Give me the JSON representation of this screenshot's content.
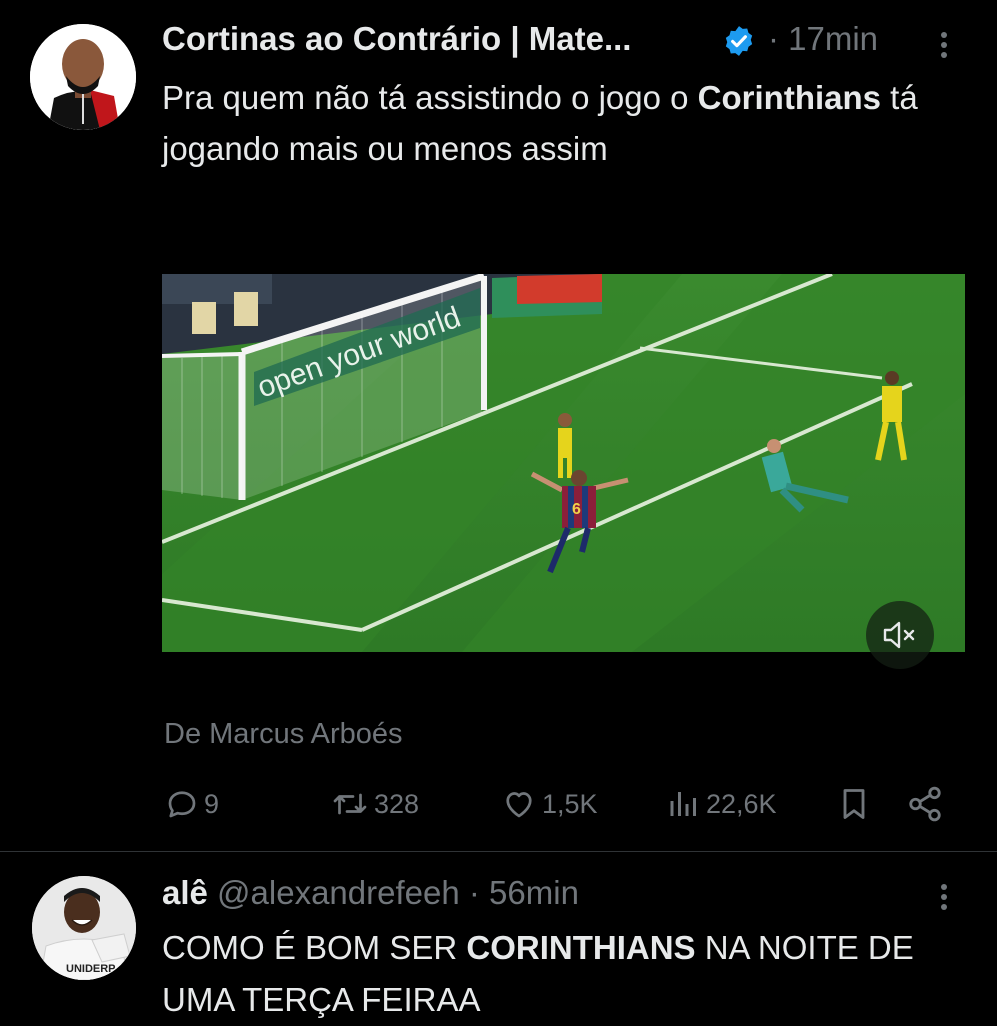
{
  "tweet1": {
    "author_name": "Cortinas ao Contrário | Mate...",
    "time": "· 17min",
    "text_before": "Pra quem não tá assistindo o jogo o ",
    "text_bold": "Corinthians",
    "text_after": " tá jogando mais ou menos assim",
    "media_banner_text": "open your world",
    "media_player_number": "6",
    "source": "De Marcus Arboés",
    "actions": {
      "replies": "9",
      "retweets": "328",
      "likes": "1,5K",
      "views": "22,6K"
    }
  },
  "tweet2": {
    "author_name": "alê",
    "handle": "@alexandrefeeh",
    "time": "· 56min",
    "text_before": "COMO É BOM SER ",
    "text_bold": "CORINTHIANS",
    "text_after": " NA NOITE DE UMA TERÇA FEIRAA",
    "avatar_shirt_text": "UNIDERP"
  },
  "icons": {
    "verified": "verified-badge-icon",
    "more": "more-vertical-icon",
    "reply": "reply-icon",
    "retweet": "retweet-icon",
    "like": "heart-icon",
    "views": "views-chart-icon",
    "bookmark": "bookmark-icon",
    "share": "share-icon",
    "mute": "muted-speaker-icon"
  },
  "colors": {
    "background": "#000000",
    "text": "#e7e9ea",
    "muted": "#71767b",
    "verified": "#1d9bf0",
    "divider": "#2f3336"
  }
}
